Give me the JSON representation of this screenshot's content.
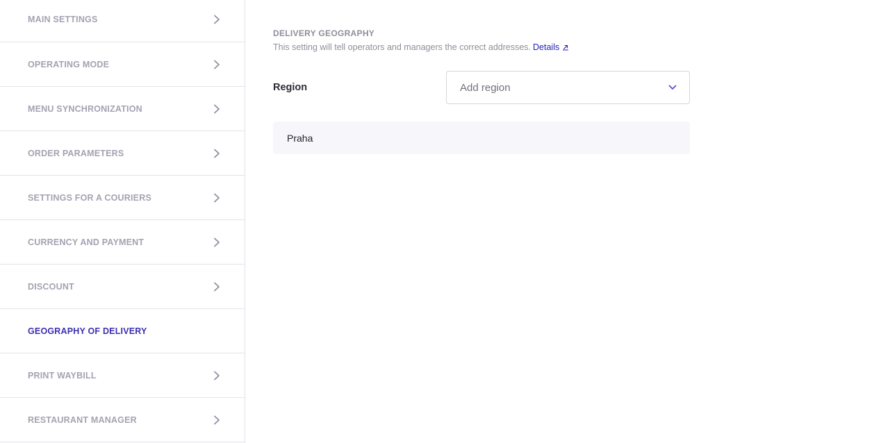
{
  "sidebar": {
    "items": [
      {
        "label": "MAIN SETTINGS",
        "active": false
      },
      {
        "label": "OPERATING MODE",
        "active": false
      },
      {
        "label": "MENU SYNCHRONIZATION",
        "active": false
      },
      {
        "label": "ORDER PARAMETERS",
        "active": false
      },
      {
        "label": "SETTINGS FOR A COURIERS",
        "active": false
      },
      {
        "label": "CURRENCY AND PAYMENT",
        "active": false
      },
      {
        "label": "DISCOUNT",
        "active": false
      },
      {
        "label": "GEOGRAPHY OF DELIVERY",
        "active": true
      },
      {
        "label": "PRINT WAYBILL",
        "active": false
      },
      {
        "label": "RESTAURANT MANAGER",
        "active": false
      }
    ],
    "chevron_icon": "chevron-right-icon"
  },
  "main": {
    "section_title": "DELIVERY GEOGRAPHY",
    "description": "This setting will tell operators and managers the correct addresses.",
    "details_link": "Details",
    "details_icon": "external-link-icon",
    "region_label": "Region",
    "region_select": {
      "placeholder": "Add region",
      "icon": "chevron-down-icon"
    },
    "regions": [
      "Praha"
    ]
  },
  "colors": {
    "accent": "#3a2fb0",
    "link": "#1f1fb5",
    "muted_text": "#a3a3b1",
    "chevron": "#8f8fa0",
    "select_chevron": "#5b4fd0",
    "border": "#e3e3ea",
    "card_bg": "#f7f7fb"
  }
}
